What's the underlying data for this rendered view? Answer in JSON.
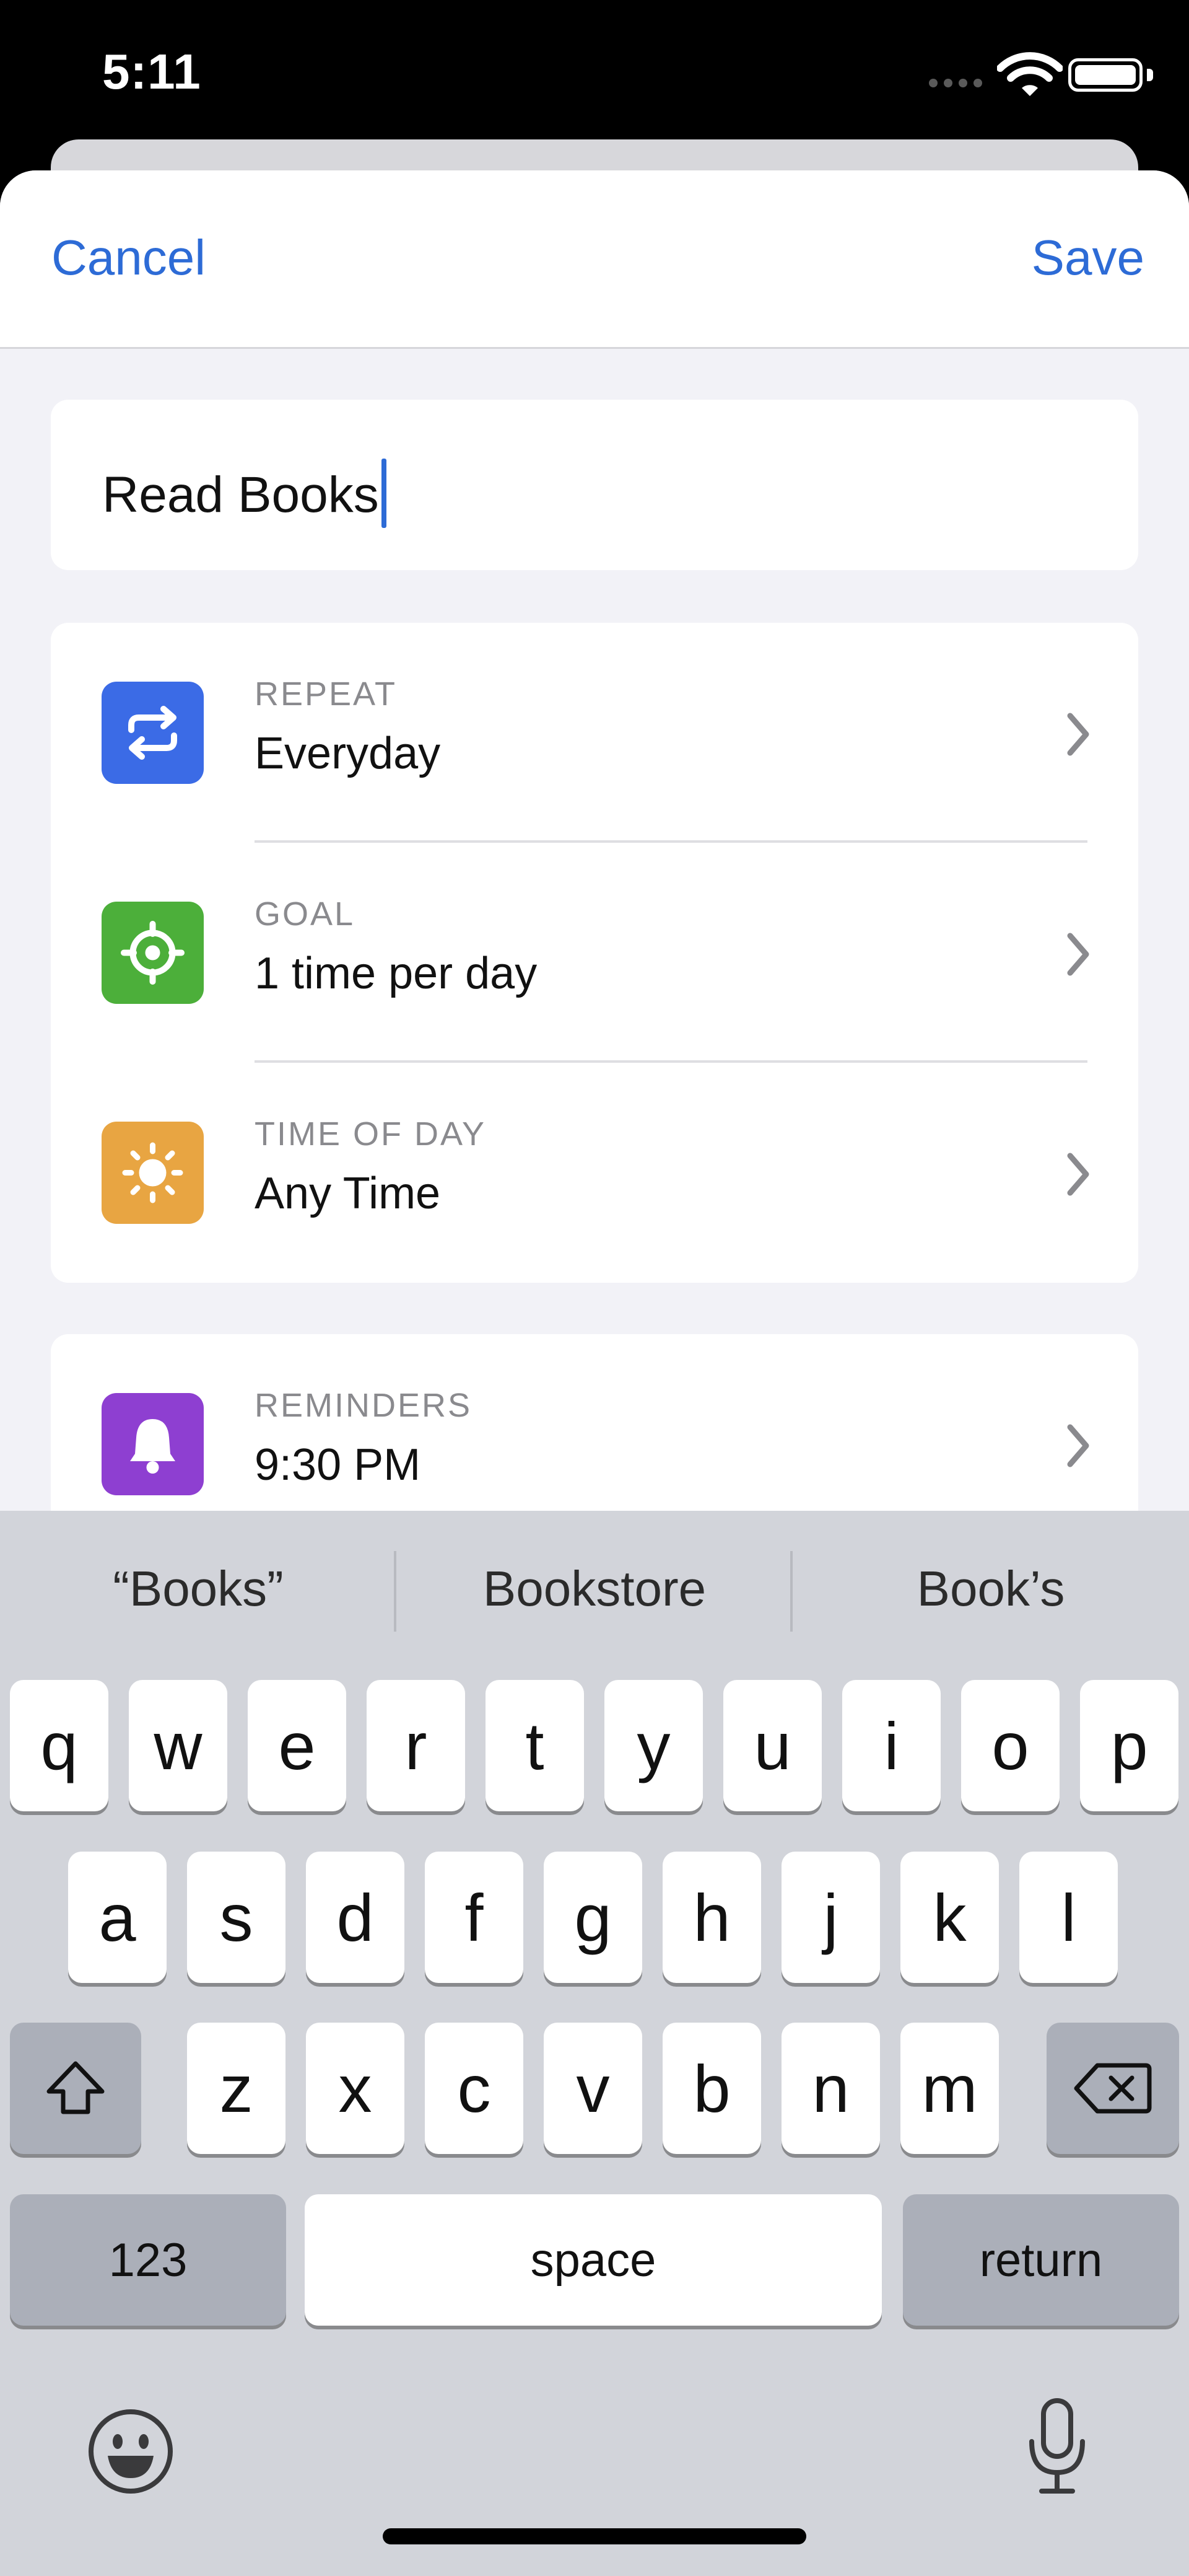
{
  "status_bar": {
    "time": "5:11",
    "icons": [
      "cellular-signal-icon",
      "wifi-icon",
      "battery-icon"
    ]
  },
  "nav": {
    "cancel_label": "Cancel",
    "save_label": "Save",
    "accent_color": "#2D6BD6"
  },
  "habit": {
    "title": "Read Books"
  },
  "settings": [
    {
      "label": "REPEAT",
      "value": "Everyday",
      "icon": "repeat-icon",
      "color": "#3B6BE6"
    },
    {
      "label": "GOAL",
      "value": "1 time per day",
      "icon": "target-icon",
      "color": "#4CAF3A"
    },
    {
      "label": "TIME OF DAY",
      "value": "Any Time",
      "icon": "sun-icon",
      "color": "#E8A542"
    }
  ],
  "reminders": {
    "label": "REMINDERS",
    "value": "9:30 PM",
    "icon": "bell-icon",
    "color": "#8E3FD1"
  },
  "keyboard": {
    "suggestions": [
      "“Books”",
      "Bookstore",
      "Book’s"
    ],
    "row1": [
      "q",
      "w",
      "e",
      "r",
      "t",
      "y",
      "u",
      "i",
      "o",
      "p"
    ],
    "row2": [
      "a",
      "s",
      "d",
      "f",
      "g",
      "h",
      "j",
      "k",
      "l"
    ],
    "row3": [
      "z",
      "x",
      "c",
      "v",
      "b",
      "n",
      "m"
    ],
    "numbers_label": "123",
    "space_label": "space",
    "return_label": "return"
  }
}
